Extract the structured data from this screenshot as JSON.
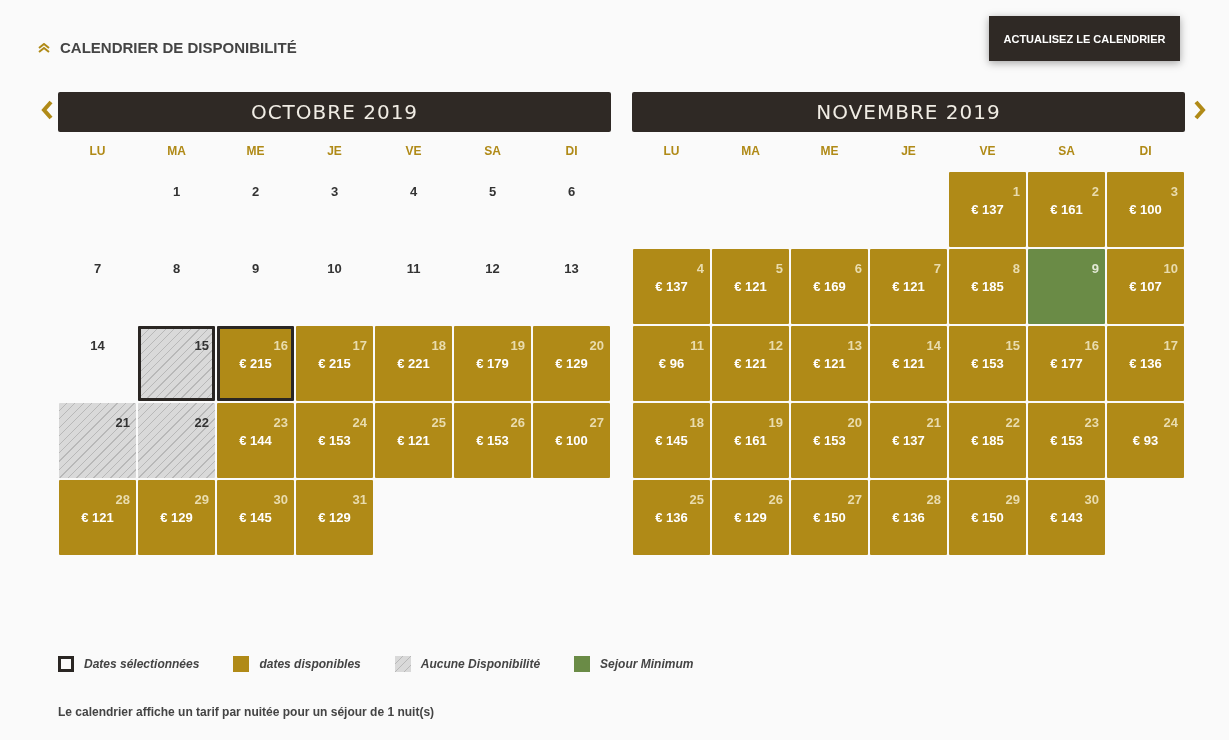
{
  "section_title": "CALENDRIER DE DISPONIBILITÉ",
  "refresh_button": "ACTUALISEZ LE CALENDRIER",
  "months": [
    {
      "title": "OCTOBRE 2019",
      "weekdays": [
        "LU",
        "MA",
        "ME",
        "JE",
        "VE",
        "SA",
        "DI"
      ],
      "weeks": [
        [
          {
            "kind": "empty"
          },
          {
            "kind": "plain",
            "day": "1"
          },
          {
            "kind": "plain",
            "day": "2"
          },
          {
            "kind": "plain",
            "day": "3"
          },
          {
            "kind": "plain",
            "day": "4"
          },
          {
            "kind": "plain",
            "day": "5"
          },
          {
            "kind": "plain",
            "day": "6"
          }
        ],
        [
          {
            "kind": "plain",
            "day": "7"
          },
          {
            "kind": "plain",
            "day": "8"
          },
          {
            "kind": "plain",
            "day": "9"
          },
          {
            "kind": "plain",
            "day": "10"
          },
          {
            "kind": "plain",
            "day": "11"
          },
          {
            "kind": "plain",
            "day": "12"
          },
          {
            "kind": "plain",
            "day": "13"
          }
        ],
        [
          {
            "kind": "plain",
            "day": "14"
          },
          {
            "kind": "unavailable",
            "day": "15",
            "selected": true
          },
          {
            "kind": "available",
            "day": "16",
            "price": "€ 215",
            "selected": true
          },
          {
            "kind": "available",
            "day": "17",
            "price": "€ 215",
            "selected": false
          },
          {
            "kind": "available",
            "day": "18",
            "price": "€ 221",
            "selected": false
          },
          {
            "kind": "available",
            "day": "19",
            "price": "€ 179",
            "selected": false
          },
          {
            "kind": "available",
            "day": "20",
            "price": "€ 129",
            "selected": false
          }
        ],
        [
          {
            "kind": "unavailable",
            "day": "21",
            "selected": false
          },
          {
            "kind": "unavailable",
            "day": "22",
            "selected": false
          },
          {
            "kind": "available",
            "day": "23",
            "price": "€ 144",
            "selected": false
          },
          {
            "kind": "available",
            "day": "24",
            "price": "€ 153",
            "selected": false
          },
          {
            "kind": "available",
            "day": "25",
            "price": "€ 121",
            "selected": false
          },
          {
            "kind": "available",
            "day": "26",
            "price": "€ 153",
            "selected": false
          },
          {
            "kind": "available",
            "day": "27",
            "price": "€ 100",
            "selected": false
          }
        ],
        [
          {
            "kind": "available",
            "day": "28",
            "price": "€ 121",
            "selected": false
          },
          {
            "kind": "available",
            "day": "29",
            "price": "€ 129",
            "selected": false
          },
          {
            "kind": "available",
            "day": "30",
            "price": "€ 145",
            "selected": false
          },
          {
            "kind": "available",
            "day": "31",
            "price": "€ 129",
            "selected": false
          }
        ]
      ]
    },
    {
      "title": "NOVEMBRE 2019",
      "weekdays": [
        "LU",
        "MA",
        "ME",
        "JE",
        "VE",
        "SA",
        "DI"
      ],
      "weeks": [
        [
          {
            "kind": "empty"
          },
          {
            "kind": "empty"
          },
          {
            "kind": "empty"
          },
          {
            "kind": "empty"
          },
          {
            "kind": "available",
            "day": "1",
            "price": "€ 137",
            "selected": false
          },
          {
            "kind": "available",
            "day": "2",
            "price": "€ 161",
            "selected": false
          },
          {
            "kind": "available",
            "day": "3",
            "price": "€ 100",
            "selected": false
          }
        ],
        [
          {
            "kind": "available",
            "day": "4",
            "price": "€ 137",
            "selected": false
          },
          {
            "kind": "available",
            "day": "5",
            "price": "€ 121",
            "selected": false
          },
          {
            "kind": "available",
            "day": "6",
            "price": "€ 169",
            "selected": false
          },
          {
            "kind": "available",
            "day": "7",
            "price": "€ 121",
            "selected": false
          },
          {
            "kind": "available",
            "day": "8",
            "price": "€ 185",
            "selected": false
          },
          {
            "kind": "minimum",
            "day": "9",
            "selected": false
          },
          {
            "kind": "available",
            "day": "10",
            "price": "€ 107",
            "selected": false
          }
        ],
        [
          {
            "kind": "available",
            "day": "11",
            "price": "€ 96",
            "selected": false
          },
          {
            "kind": "available",
            "day": "12",
            "price": "€ 121",
            "selected": false
          },
          {
            "kind": "available",
            "day": "13",
            "price": "€ 121",
            "selected": false
          },
          {
            "kind": "available",
            "day": "14",
            "price": "€ 121",
            "selected": false
          },
          {
            "kind": "available",
            "day": "15",
            "price": "€ 153",
            "selected": false
          },
          {
            "kind": "available",
            "day": "16",
            "price": "€ 177",
            "selected": false
          },
          {
            "kind": "available",
            "day": "17",
            "price": "€ 136",
            "selected": false
          }
        ],
        [
          {
            "kind": "available",
            "day": "18",
            "price": "€ 145",
            "selected": false
          },
          {
            "kind": "available",
            "day": "19",
            "price": "€ 161",
            "selected": false
          },
          {
            "kind": "available",
            "day": "20",
            "price": "€ 153",
            "selected": false
          },
          {
            "kind": "available",
            "day": "21",
            "price": "€ 137",
            "selected": false
          },
          {
            "kind": "available",
            "day": "22",
            "price": "€ 185",
            "selected": false
          },
          {
            "kind": "available",
            "day": "23",
            "price": "€ 153",
            "selected": false
          },
          {
            "kind": "available",
            "day": "24",
            "price": "€ 93",
            "selected": false
          }
        ],
        [
          {
            "kind": "available",
            "day": "25",
            "price": "€ 136",
            "selected": false
          },
          {
            "kind": "available",
            "day": "26",
            "price": "€ 129",
            "selected": false
          },
          {
            "kind": "available",
            "day": "27",
            "price": "€ 150",
            "selected": false
          },
          {
            "kind": "available",
            "day": "28",
            "price": "€ 136",
            "selected": false
          },
          {
            "kind": "available",
            "day": "29",
            "price": "€ 150",
            "selected": false
          },
          {
            "kind": "available",
            "day": "30",
            "price": "€ 143",
            "selected": false
          }
        ]
      ]
    }
  ],
  "legend": [
    {
      "kind": "selected",
      "label": "Dates sélectionnées"
    },
    {
      "kind": "available",
      "label": "dates disponibles"
    },
    {
      "kind": "unavailable",
      "label": "Aucune Disponibilité"
    },
    {
      "kind": "minimum",
      "label": "Sejour Minimum"
    }
  ],
  "footnote": "Le calendrier affiche un tarif par nuitée pour un séjour de 1 nuit(s)"
}
